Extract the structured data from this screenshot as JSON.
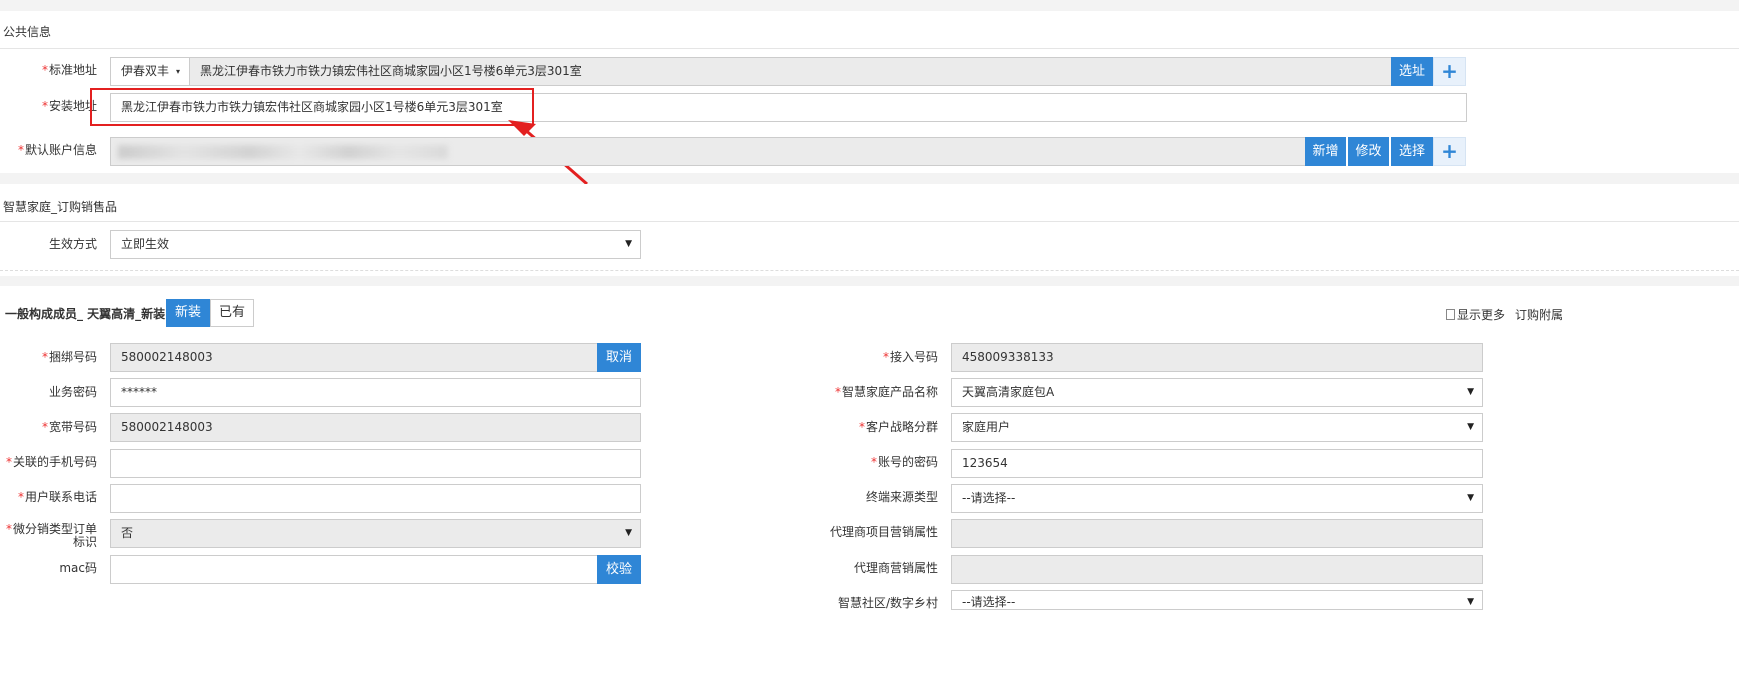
{
  "public_info": {
    "title": "公共信息",
    "std_address": {
      "label": "标准地址",
      "region": "伊春双丰",
      "value": "黑龙江伊春市铁力市铁力镇宏伟社区商城家园小区1号楼6单元3层301室",
      "select_btn": "选址",
      "plus": "+"
    },
    "install_address": {
      "label": "安装地址",
      "value": "黑龙江伊春市铁力市铁力镇宏伟社区商城家园小区1号楼6单元3层301室"
    },
    "default_account": {
      "label": "默认账户信息",
      "add_btn": "新增",
      "edit_btn": "修改",
      "choose_btn": "选择",
      "plus": "+"
    }
  },
  "product": {
    "title": "智慧家庭_订购销售品",
    "effect_mode": {
      "label": "生效方式",
      "value": "立即生效"
    }
  },
  "member": {
    "title": "一般构成成员_ 天翼高清_新装",
    "tabs": [
      "新装",
      "已有"
    ],
    "show_more": "显示更多",
    "order_attach": "订购附属",
    "left_fields": {
      "bind_number": {
        "label": "捆绑号码",
        "value": "580002148003",
        "btn": "取消"
      },
      "biz_password": {
        "label": "业务密码",
        "value": "******"
      },
      "broadband": {
        "label": "宽带号码",
        "value": "580002148003"
      },
      "linked_phone": {
        "label": "关联的手机号码",
        "value": ""
      },
      "user_phone": {
        "label": "用户联系电话",
        "value": ""
      },
      "micro_sales": {
        "label": "微分销类型订单标识",
        "value": "否"
      },
      "mac": {
        "label": "mac码",
        "value": "",
        "btn": "校验"
      }
    },
    "right_fields": {
      "access_number": {
        "label": "接入号码",
        "value": "458009338133"
      },
      "product_name": {
        "label": "智慧家庭产品名称",
        "value": "天翼高清家庭包A"
      },
      "customer_group": {
        "label": "客户战略分群",
        "value": "家庭用户"
      },
      "account_password": {
        "label": "账号的密码",
        "value": "123654"
      },
      "terminal_source": {
        "label": "终端来源类型",
        "value": "--请选择--"
      },
      "agent_project": {
        "label": "代理商项目营销属性",
        "value": ""
      },
      "agent_marketing": {
        "label": "代理商营销属性",
        "value": ""
      },
      "smart_community": {
        "label": "智慧社区/数字乡村",
        "value": "--请选择--"
      }
    }
  },
  "colors": {
    "accent": "#2f86d6",
    "required": "#e33333",
    "highlight": "#e32020"
  }
}
